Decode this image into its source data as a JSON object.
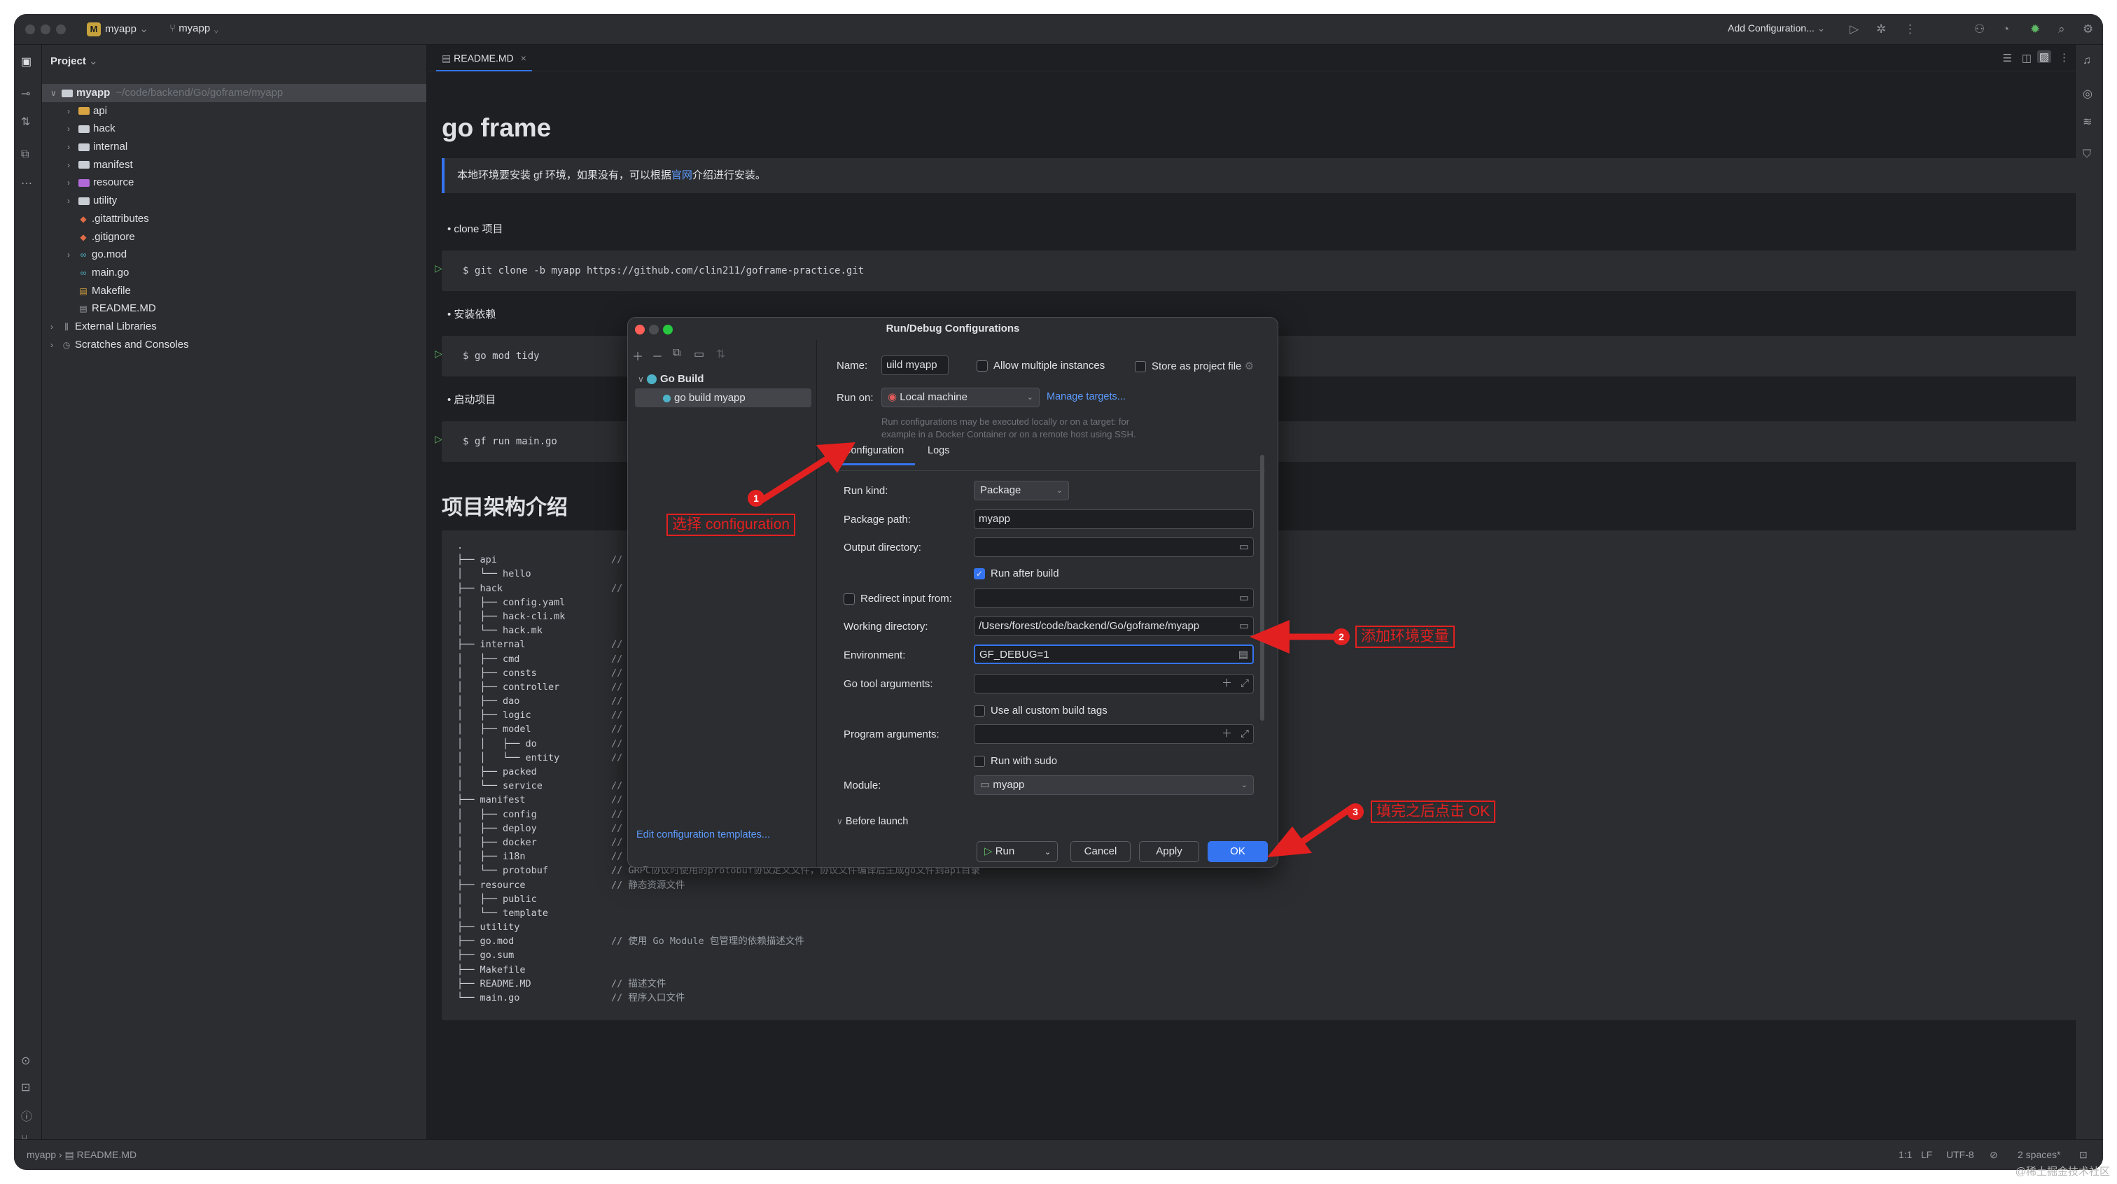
{
  "titlebar": {
    "project_badge": "M",
    "project": "myapp",
    "branch": "myapp",
    "add_config": "Add Configuration..."
  },
  "project_panel": {
    "title": "Project",
    "tree": [
      {
        "label": "myapp",
        "hint": "~/code/backend/Go/goframe/myapp",
        "kind": "root",
        "chevron": "∨"
      },
      {
        "label": "api",
        "kind": "folder-api",
        "chevron": "›"
      },
      {
        "label": "hack",
        "kind": "folder",
        "chevron": "›"
      },
      {
        "label": "internal",
        "kind": "folder",
        "chevron": "›"
      },
      {
        "label": "manifest",
        "kind": "folder",
        "chevron": "›"
      },
      {
        "label": "resource",
        "kind": "folder-res",
        "chevron": "›"
      },
      {
        "label": "utility",
        "kind": "folder",
        "chevron": "›"
      },
      {
        "label": ".gitattributes",
        "kind": "git",
        "chevron": ""
      },
      {
        "label": ".gitignore",
        "kind": "git",
        "chevron": ""
      },
      {
        "label": "go.mod",
        "kind": "gomod",
        "chevron": "›"
      },
      {
        "label": "main.go",
        "kind": "go",
        "chevron": ""
      },
      {
        "label": "Makefile",
        "kind": "make",
        "chevron": ""
      },
      {
        "label": "README.MD",
        "kind": "md",
        "chevron": ""
      },
      {
        "label": "External Libraries",
        "kind": "lib",
        "chevron": "›"
      },
      {
        "label": "Scratches and Consoles",
        "kind": "scratch",
        "chevron": "›"
      }
    ]
  },
  "editor": {
    "tab": "README.MD",
    "h1": "go frame",
    "blockquote_pre": "本地环境要安装 gf 环境，如果没有，可以根据",
    "blockquote_link": "官网",
    "blockquote_post": "介绍进行安装。",
    "bullets": [
      "clone 项目",
      "安装依赖",
      "启动项目"
    ],
    "code_blocks": [
      "$ git clone -b myapp https://github.com/clin211/goframe-practice.git",
      "$ go mod tidy",
      "$ gf run main.go"
    ],
    "h2": "项目架构介绍",
    "tree_lines": [
      {
        "t": ".",
        "c": ""
      },
      {
        "t": "├── api",
        "c": "//"
      },
      {
        "t": "│   └── hello",
        "c": ""
      },
      {
        "t": "├── hack",
        "c": "//"
      },
      {
        "t": "│   ├── config.yaml",
        "c": ""
      },
      {
        "t": "│   ├── hack-cli.mk",
        "c": ""
      },
      {
        "t": "│   └── hack.mk",
        "c": ""
      },
      {
        "t": "├── internal",
        "c": "//"
      },
      {
        "t": "│   ├── cmd",
        "c": "//"
      },
      {
        "t": "│   ├── consts",
        "c": "//"
      },
      {
        "t": "│   ├── controller",
        "c": "//"
      },
      {
        "t": "│   ├── dao",
        "c": "//"
      },
      {
        "t": "│   ├── logic",
        "c": "//"
      },
      {
        "t": "│   ├── model",
        "c": "//"
      },
      {
        "t": "│   │   ├── do",
        "c": "//"
      },
      {
        "t": "│   │   └── entity",
        "c": "//"
      },
      {
        "t": "│   ├── packed",
        "c": ""
      },
      {
        "t": "│   └── service",
        "c": "//"
      },
      {
        "t": "├── manifest",
        "c": "//"
      },
      {
        "t": "│   ├── config",
        "c": "//"
      },
      {
        "t": "│   ├── deploy",
        "c": "//"
      },
      {
        "t": "│   ├── docker",
        "c": "//"
      },
      {
        "t": "│   ├── i18n",
        "c": "//"
      },
      {
        "t": "│   └── protobuf",
        "c": "// GRPC协议时使用的protobuf协议定义文件，协议文件编译后生成go文件到api目录"
      },
      {
        "t": "├── resource",
        "c": "// 静态资源文件"
      },
      {
        "t": "│   ├── public",
        "c": ""
      },
      {
        "t": "│   └── template",
        "c": ""
      },
      {
        "t": "├── utility",
        "c": ""
      },
      {
        "t": "├── go.mod",
        "c": "// 使用 Go Module 包管理的依赖描述文件"
      },
      {
        "t": "├── go.sum",
        "c": ""
      },
      {
        "t": "├── Makefile",
        "c": ""
      },
      {
        "t": "├── README.MD",
        "c": "// 描述文件"
      },
      {
        "t": "└── main.go",
        "c": "// 程序入口文件"
      }
    ]
  },
  "dialog": {
    "title": "Run/Debug Configurations",
    "tree_group": "Go Build",
    "tree_item": "go build myapp",
    "edit_templates": "Edit configuration templates...",
    "help": "?",
    "name_label": "Name:",
    "name_value": "uild myapp",
    "allow_multiple": "Allow multiple instances",
    "store_project": "Store as project file",
    "run_on_label": "Run on:",
    "run_on_value": "Local machine",
    "manage_targets": "Manage targets...",
    "note_line1": "Run configurations may be executed locally or on a target: for",
    "note_line2": "example in a Docker Container or on a remote host using SSH.",
    "tab_config": "Configuration",
    "tab_logs": "Logs",
    "run_kind_label": "Run kind:",
    "run_kind_value": "Package",
    "package_path_label": "Package path:",
    "package_path_value": "myapp",
    "output_dir_label": "Output directory:",
    "run_after_build": "Run after build",
    "redirect_input": "Redirect input from:",
    "working_dir_label": "Working directory:",
    "working_dir_value": "/Users/forest/code/backend/Go/goframe/myapp",
    "env_label": "Environment:",
    "env_value": "GF_DEBUG=1",
    "go_tool_args_label": "Go tool arguments:",
    "use_custom_tags": "Use all custom build tags",
    "program_args_label": "Program arguments:",
    "run_with_sudo": "Run with sudo",
    "module_label": "Module:",
    "module_value": "myapp",
    "before_launch": "Before launch",
    "btn_run": "Run",
    "btn_cancel": "Cancel",
    "btn_apply": "Apply",
    "btn_ok": "OK"
  },
  "annotations": [
    {
      "num": "1",
      "text": "选择 configuration"
    },
    {
      "num": "2",
      "text": "添加环境变量"
    },
    {
      "num": "3",
      "text": "填完之后点击 OK"
    }
  ],
  "statusbar": {
    "breadcrumb_project": "myapp",
    "breadcrumb_file": "README.MD",
    "position": "1:1",
    "line_sep": "LF",
    "encoding": "UTF-8",
    "indent": "2 spaces*"
  },
  "watermark": "@稀土掘金技术社区",
  "colors": {
    "accent": "#3574f0",
    "annotation": "#e32020",
    "link": "#5e9cff"
  }
}
